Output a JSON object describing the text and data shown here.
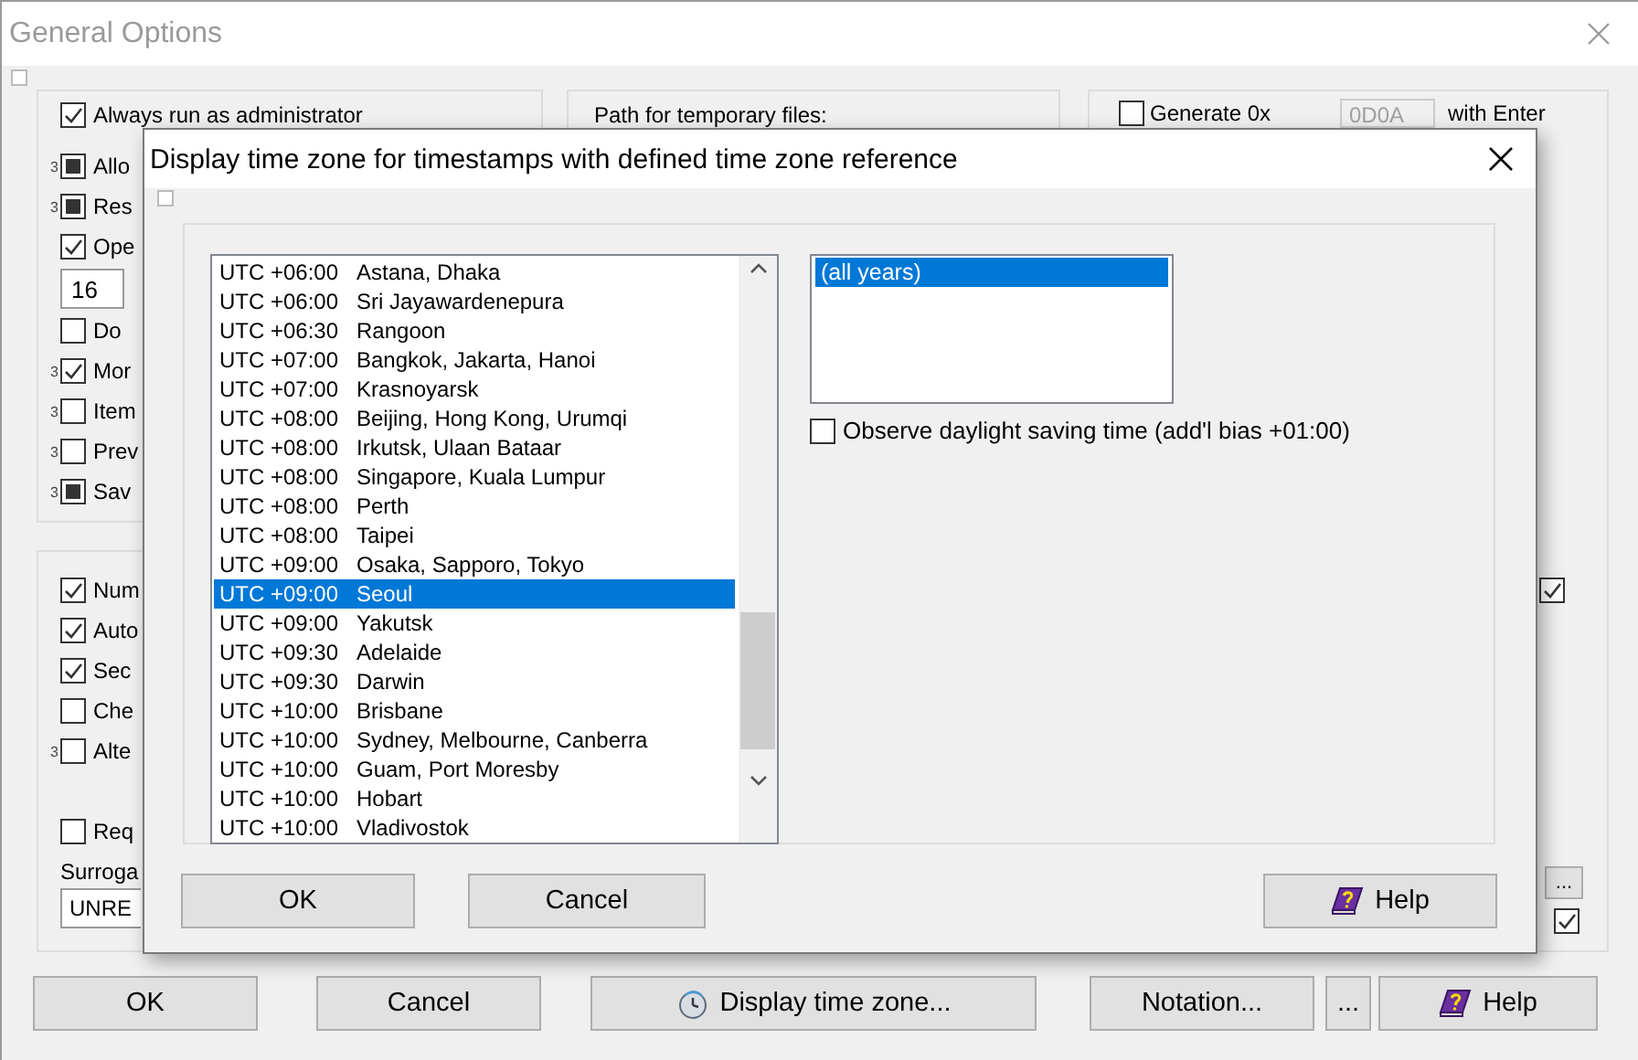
{
  "window": {
    "title": "General Options"
  },
  "left_group": {
    "options": [
      {
        "kind": "checkbox",
        "label": "Always run as administrator",
        "checked": true,
        "indeterminate": false
      },
      {
        "kind": "checkbox",
        "label": "Allo",
        "checked": false,
        "indeterminate": true,
        "marker": "3"
      },
      {
        "kind": "checkbox",
        "label": "Res",
        "checked": false,
        "indeterminate": true,
        "marker": "3"
      },
      {
        "kind": "checkbox",
        "label": "Ope",
        "checked": true,
        "indeterminate": false
      },
      {
        "kind": "number",
        "value": "16"
      },
      {
        "kind": "checkbox",
        "label": "Do",
        "checked": false,
        "indeterminate": false
      },
      {
        "kind": "checkbox",
        "label": "Mor",
        "checked": true,
        "indeterminate": false,
        "marker": "3"
      },
      {
        "kind": "checkbox",
        "label": "Item",
        "checked": false,
        "indeterminate": false,
        "marker": "3"
      },
      {
        "kind": "checkbox",
        "label": "Prev",
        "checked": false,
        "indeterminate": false,
        "marker": "3"
      },
      {
        "kind": "checkbox",
        "label": "Sav",
        "checked": false,
        "indeterminate": true,
        "marker": "3"
      }
    ]
  },
  "lower_group": {
    "options": [
      {
        "label": "Num",
        "checked": true
      },
      {
        "label": "Auto",
        "checked": true
      },
      {
        "label": "Sec",
        "checked": true
      },
      {
        "label": "Che",
        "checked": false
      },
      {
        "label": "Alte",
        "checked": false,
        "marker": "3"
      }
    ],
    "required_option": {
      "label": "Req",
      "checked": false
    },
    "surrogate_label": "Surroga",
    "surrogate_value": "UNRE"
  },
  "middle_group": {
    "label": "Path for temporary files:"
  },
  "right_group": {
    "generate": {
      "label": "Generate 0x",
      "checked": false
    },
    "hex_field": {
      "value": "0D0A",
      "disabled": true
    },
    "suffix": "with Enter",
    "edge_check_top": {
      "checked": true
    },
    "more_button": "...",
    "edge_check_bottom": {
      "checked": true
    }
  },
  "buttons": [
    {
      "label": "OK",
      "kind": "plain"
    },
    {
      "label": "Cancel",
      "kind": "plain"
    },
    {
      "label": "Display time zone...",
      "kind": "clock"
    },
    {
      "label": "Notation...",
      "kind": "plain"
    },
    {
      "label": "...",
      "kind": "plain"
    },
    {
      "label": "Help",
      "kind": "help"
    }
  ],
  "dialog": {
    "title": "Display time zone for timestamps with defined time zone reference",
    "zones": [
      {
        "offset": "UTC +06:00",
        "city": "Astana, Dhaka",
        "selected": false
      },
      {
        "offset": "UTC +06:00",
        "city": "Sri Jayawardenepura",
        "selected": false
      },
      {
        "offset": "UTC +06:30",
        "city": "Rangoon",
        "selected": false
      },
      {
        "offset": "UTC +07:00",
        "city": "Bangkok, Jakarta, Hanoi",
        "selected": false
      },
      {
        "offset": "UTC +07:00",
        "city": "Krasnoyarsk",
        "selected": false
      },
      {
        "offset": "UTC +08:00",
        "city": "Beijing, Hong Kong, Urumqi",
        "selected": false
      },
      {
        "offset": "UTC +08:00",
        "city": "Irkutsk, Ulaan Bataar",
        "selected": false
      },
      {
        "offset": "UTC +08:00",
        "city": "Singapore, Kuala Lumpur",
        "selected": false
      },
      {
        "offset": "UTC +08:00",
        "city": "Perth",
        "selected": false
      },
      {
        "offset": "UTC +08:00",
        "city": "Taipei",
        "selected": false
      },
      {
        "offset": "UTC +09:00",
        "city": "Osaka, Sapporo, Tokyo",
        "selected": false
      },
      {
        "offset": "UTC +09:00",
        "city": "Seoul",
        "selected": true
      },
      {
        "offset": "UTC +09:00",
        "city": "Yakutsk",
        "selected": false
      },
      {
        "offset": "UTC +09:30",
        "city": "Adelaide",
        "selected": false
      },
      {
        "offset": "UTC +09:30",
        "city": "Darwin",
        "selected": false
      },
      {
        "offset": "UTC +10:00",
        "city": "Brisbane",
        "selected": false
      },
      {
        "offset": "UTC +10:00",
        "city": "Sydney, Melbourne, Canberra",
        "selected": false
      },
      {
        "offset": "UTC +10:00",
        "city": "Guam, Port Moresby",
        "selected": false
      },
      {
        "offset": "UTC +10:00",
        "city": "Hobart",
        "selected": false
      },
      {
        "offset": "UTC +10:00",
        "city": "Vladivostok",
        "selected": false
      }
    ],
    "years": [
      {
        "label": "(all years)",
        "selected": true
      }
    ],
    "dst": {
      "label": "Observe daylight saving time (add'l bias +01:00)",
      "checked": false
    },
    "buttons": [
      {
        "label": "OK",
        "kind": "plain"
      },
      {
        "label": "Cancel",
        "kind": "plain"
      },
      {
        "label": "Help",
        "kind": "help"
      }
    ]
  }
}
